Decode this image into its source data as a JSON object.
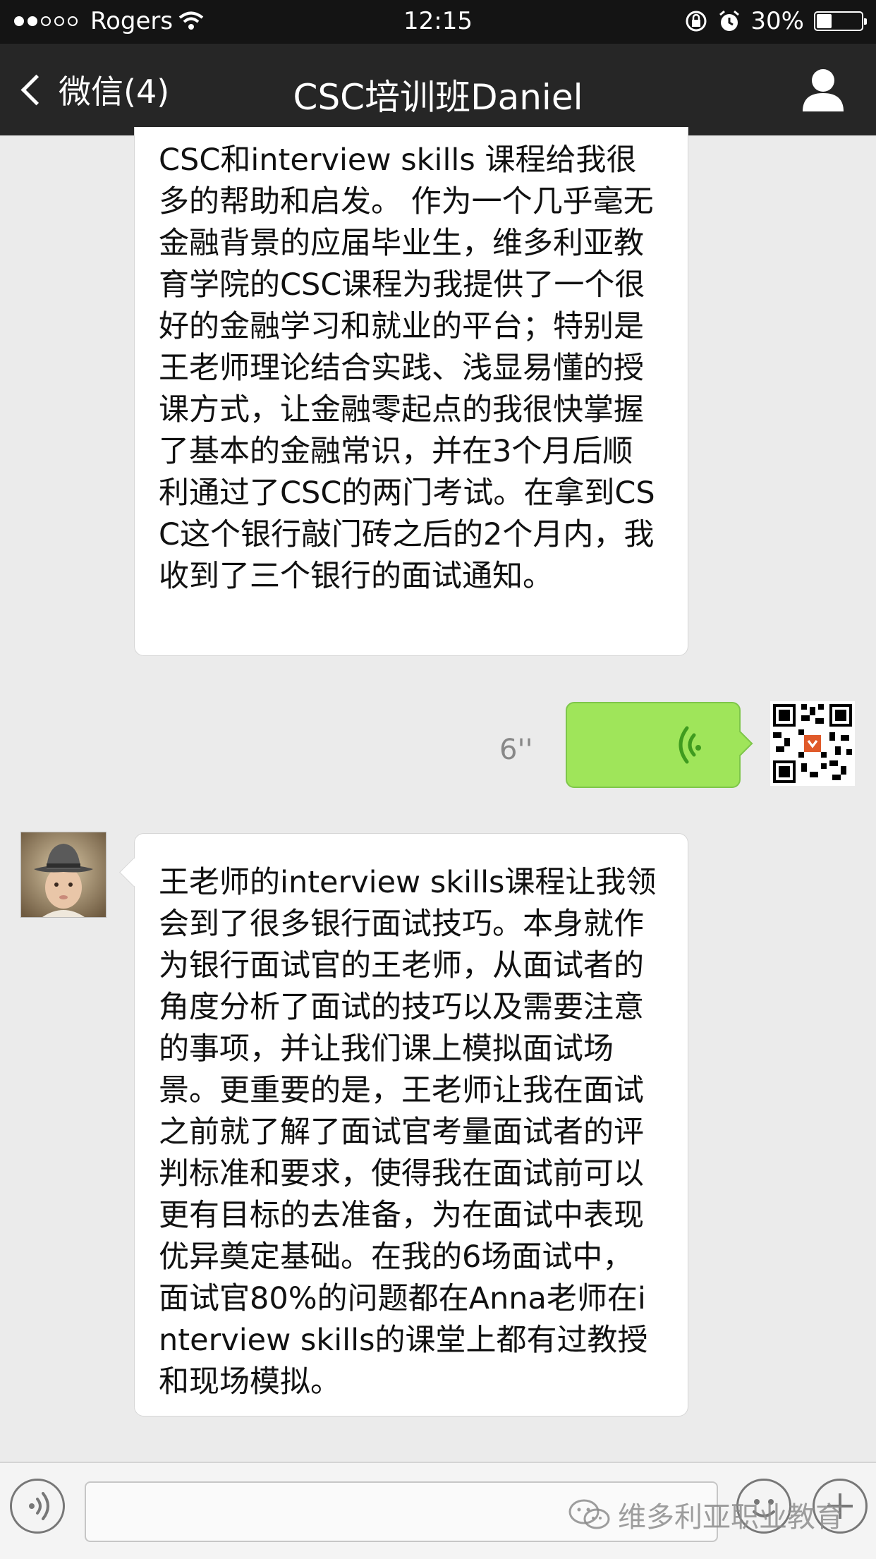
{
  "status_bar": {
    "carrier": "Rogers",
    "time": "12:15",
    "battery": "30%",
    "signal_bars_filled": 2,
    "signal_bars_total": 5
  },
  "nav": {
    "back_label": "微信(4)",
    "title": "CSC培训班Daniel"
  },
  "messages": {
    "first": {
      "text": "CSC和interview skills 课程给我很多的帮助和启发。 作为一个几乎毫无金融背景的应届毕业生，维多利亚教育学院的CSC课程为我提供了一个很好的金融学习和就业的平台；特别是王老师理论结合实践、浅显易懂的授课方式，让金融零起点的我很快掌握了基本的金融常识，并在3个月后顺利通过了CSC的两门考试。在拿到CSC这个银行敲门砖之后的2个月内，我收到了三个银行的面试通知。"
    },
    "voice": {
      "duration": "6''"
    },
    "second": {
      "text": "王老师的interview skills课程让我领会到了很多银行面试技巧。本身就作为银行面试官的王老师，从面试者的角度分析了面试的技巧以及需要注意的事项，并让我们课上模拟面试场景。更重要的是，王老师让我在面试之前就了解了面试官考量面试者的评判标准和要求，使得我在面试前可以更有目标的去准备，为在面试中表现优异奠定基础。在我的6场面试中，面试官80%的问题都在Anna老师在interview skills的课堂上都有过教授和现场模拟。"
    }
  },
  "watermark": "维多利亚职业教育",
  "colors": {
    "voice_bubble": "#9fe55a",
    "navbar": "#262626",
    "background": "#ebebeb"
  }
}
